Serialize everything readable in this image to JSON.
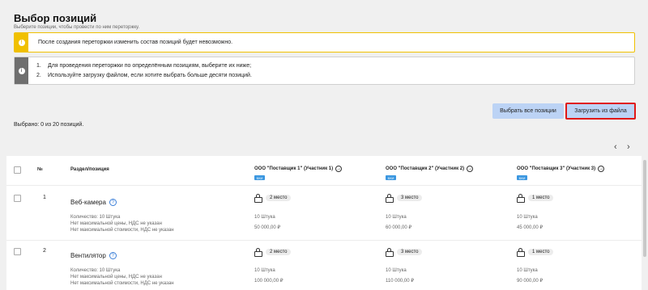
{
  "header": {
    "title": "Выбор позиций",
    "subtitle": "Выберите позиции, чтобы провести по ним переторжку."
  },
  "alerts": {
    "warning_icon": "!",
    "warning_text": "После создания переторжки изменить состав позиций будет невозможно.",
    "info_icon": "i",
    "info_items": [
      {
        "num": "1.",
        "text": "Для проведения переторжки по определённым позициям, выберите их ниже;"
      },
      {
        "num": "2.",
        "text": "Используйте загрузку файлом, если хотите выбрать больше десяти позиций."
      }
    ]
  },
  "actions": {
    "select_all_label": "Выбрать все позиции",
    "upload_label": "Загрузить из файла"
  },
  "selected_count": "Выбрано: 0 из 20 позиций.",
  "pager": {
    "prev": "‹",
    "next": "›"
  },
  "table": {
    "col_num": "№",
    "col_position": "Раздел/позиция",
    "suppliers": [
      {
        "name": "ООО \"Поставщик 1\" (Участник 1)",
        "tag": "БКИ"
      },
      {
        "name": "ООО \"Поставщик 2\" (Участник 2)",
        "tag": "БКИ"
      },
      {
        "name": "ООО \"Поставщик 3\" (Участник 3)",
        "tag": "БКИ"
      }
    ],
    "arrow_icon": "→",
    "help_icon": "?",
    "rows": [
      {
        "num": "1",
        "name": "Веб-камера",
        "qty": "Количество: 10 Штука",
        "max_price": "Нет максимальной цены, НДС не указан",
        "max_cost": "Нет максимальной стоимости, НДС не указан",
        "offers": [
          {
            "place": "2 место",
            "qty": "10 Штука",
            "price": "50 000,00 ₽"
          },
          {
            "place": "3 место",
            "qty": "10 Штука",
            "price": "60 000,00 ₽"
          },
          {
            "place": "1 место",
            "qty": "10 Штука",
            "price": "45 000,00 ₽"
          }
        ]
      },
      {
        "num": "2",
        "name": "Вентилятор",
        "qty": "Количество: 10 Штука",
        "max_price": "Нет максимальной цены, НДС не указан",
        "max_cost": "Нет максимальной стоимости, НДС не указан",
        "offers": [
          {
            "place": "2 место",
            "qty": "10 Штука",
            "price": "100 000,00 ₽"
          },
          {
            "place": "3 место",
            "qty": "10 Штука",
            "price": "110 000,00 ₽"
          },
          {
            "place": "1 место",
            "qty": "10 Штука",
            "price": "90 000,00 ₽"
          }
        ]
      }
    ]
  },
  "colors": {
    "warning": "#f0c000",
    "info_side": "#6f6f6f",
    "button_bg": "#bcd3f5",
    "highlight": "#e01818",
    "tag": "#3b97e0"
  }
}
